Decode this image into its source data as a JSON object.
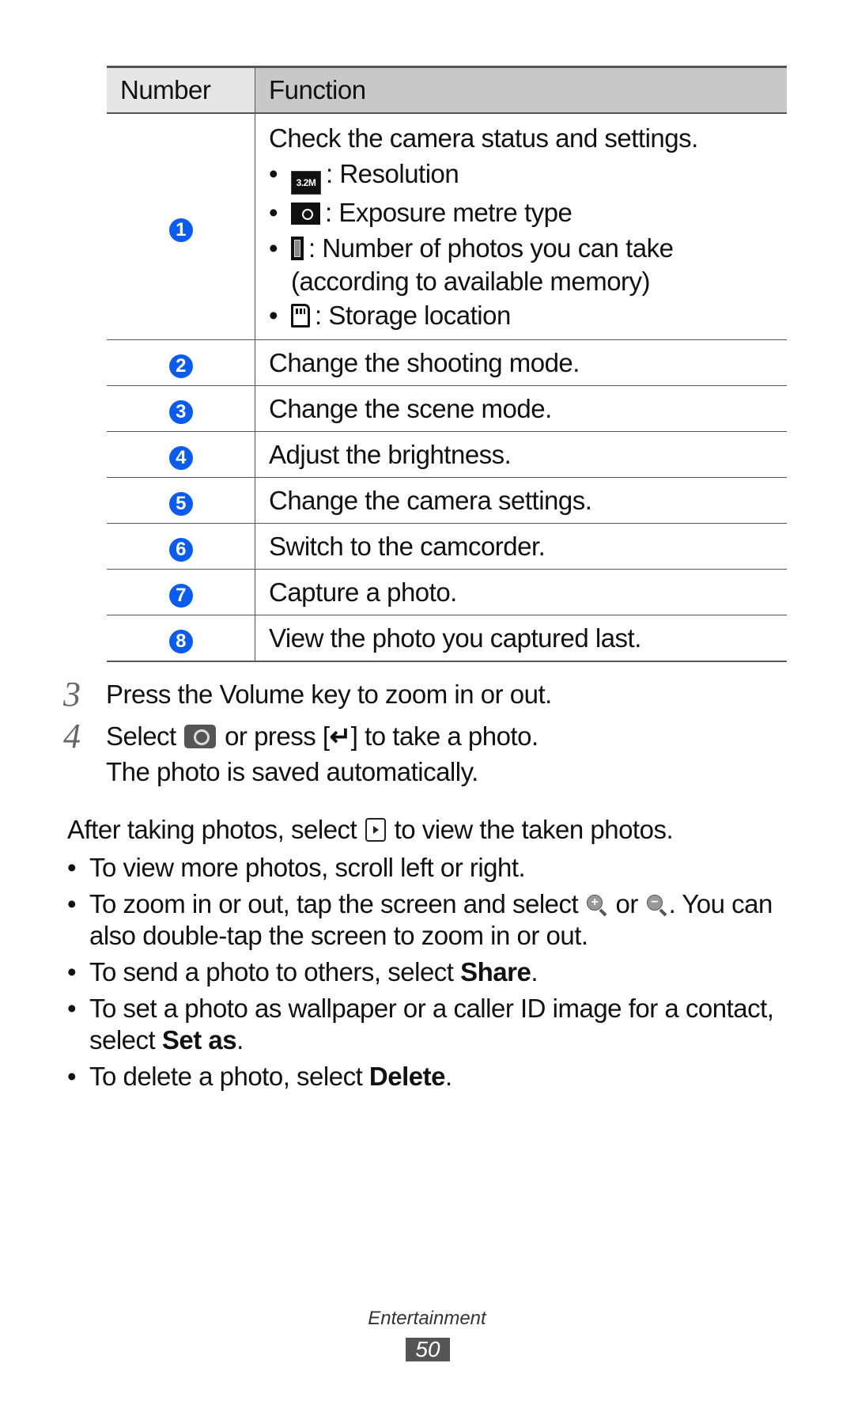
{
  "table": {
    "headers": {
      "number": "Number",
      "function": "Function"
    },
    "badge_color": "#0a5cf0",
    "rows": [
      {
        "number": "1",
        "description": "Check the camera status and settings.",
        "items": [
          {
            "icon": "resolution-icon",
            "icon_text": "3.2M",
            "label": ": Resolution"
          },
          {
            "icon": "exposure-metre-icon",
            "label": ": Exposure metre type"
          },
          {
            "icon": "photo-count-icon",
            "label": ": Number of photos you can take",
            "continuation": "(according to available memory)"
          },
          {
            "icon": "storage-location-icon",
            "label": ": Storage location"
          }
        ]
      },
      {
        "number": "2",
        "description": "Change the shooting mode."
      },
      {
        "number": "3",
        "description": "Change the scene mode."
      },
      {
        "number": "4",
        "description": "Adjust the brightness."
      },
      {
        "number": "5",
        "description": "Change the camera settings."
      },
      {
        "number": "6",
        "description": "Switch to the camcorder."
      },
      {
        "number": "7",
        "description": "Capture a photo."
      },
      {
        "number": "8",
        "description": "View the photo you captured last."
      }
    ]
  },
  "steps": [
    {
      "number": "3",
      "text": "Press the Volume key to zoom in or out."
    },
    {
      "number": "4",
      "before_icon": "Select",
      "icon": "camera-icon",
      "middle": "or press [",
      "key_glyph": "↵",
      "after": "] to take a photo.",
      "line2": "The photo is saved automatically."
    }
  ],
  "after_section": {
    "intro_before": "After taking photos, select",
    "intro_icon": "play-icon",
    "intro_after": "to view the taken photos.",
    "tips": [
      {
        "text": "To view more photos, scroll left or right."
      },
      {
        "before": "To zoom in or out, tap the screen and select",
        "zoom_in_glyph": "+",
        "middle": "or",
        "zoom_out_glyph": "−",
        "after": ". You can also double-tap the screen to zoom in or out."
      },
      {
        "before": "To send a photo to others, select ",
        "bold": "Share",
        "after": "."
      },
      {
        "before": "To set a photo as wallpaper or a caller ID image for a contact, select ",
        "bold": "Set as",
        "after": "."
      },
      {
        "before": "To delete a photo, select ",
        "bold": "Delete",
        "after": "."
      }
    ]
  },
  "footer": {
    "section": "Entertainment",
    "page": "50"
  }
}
